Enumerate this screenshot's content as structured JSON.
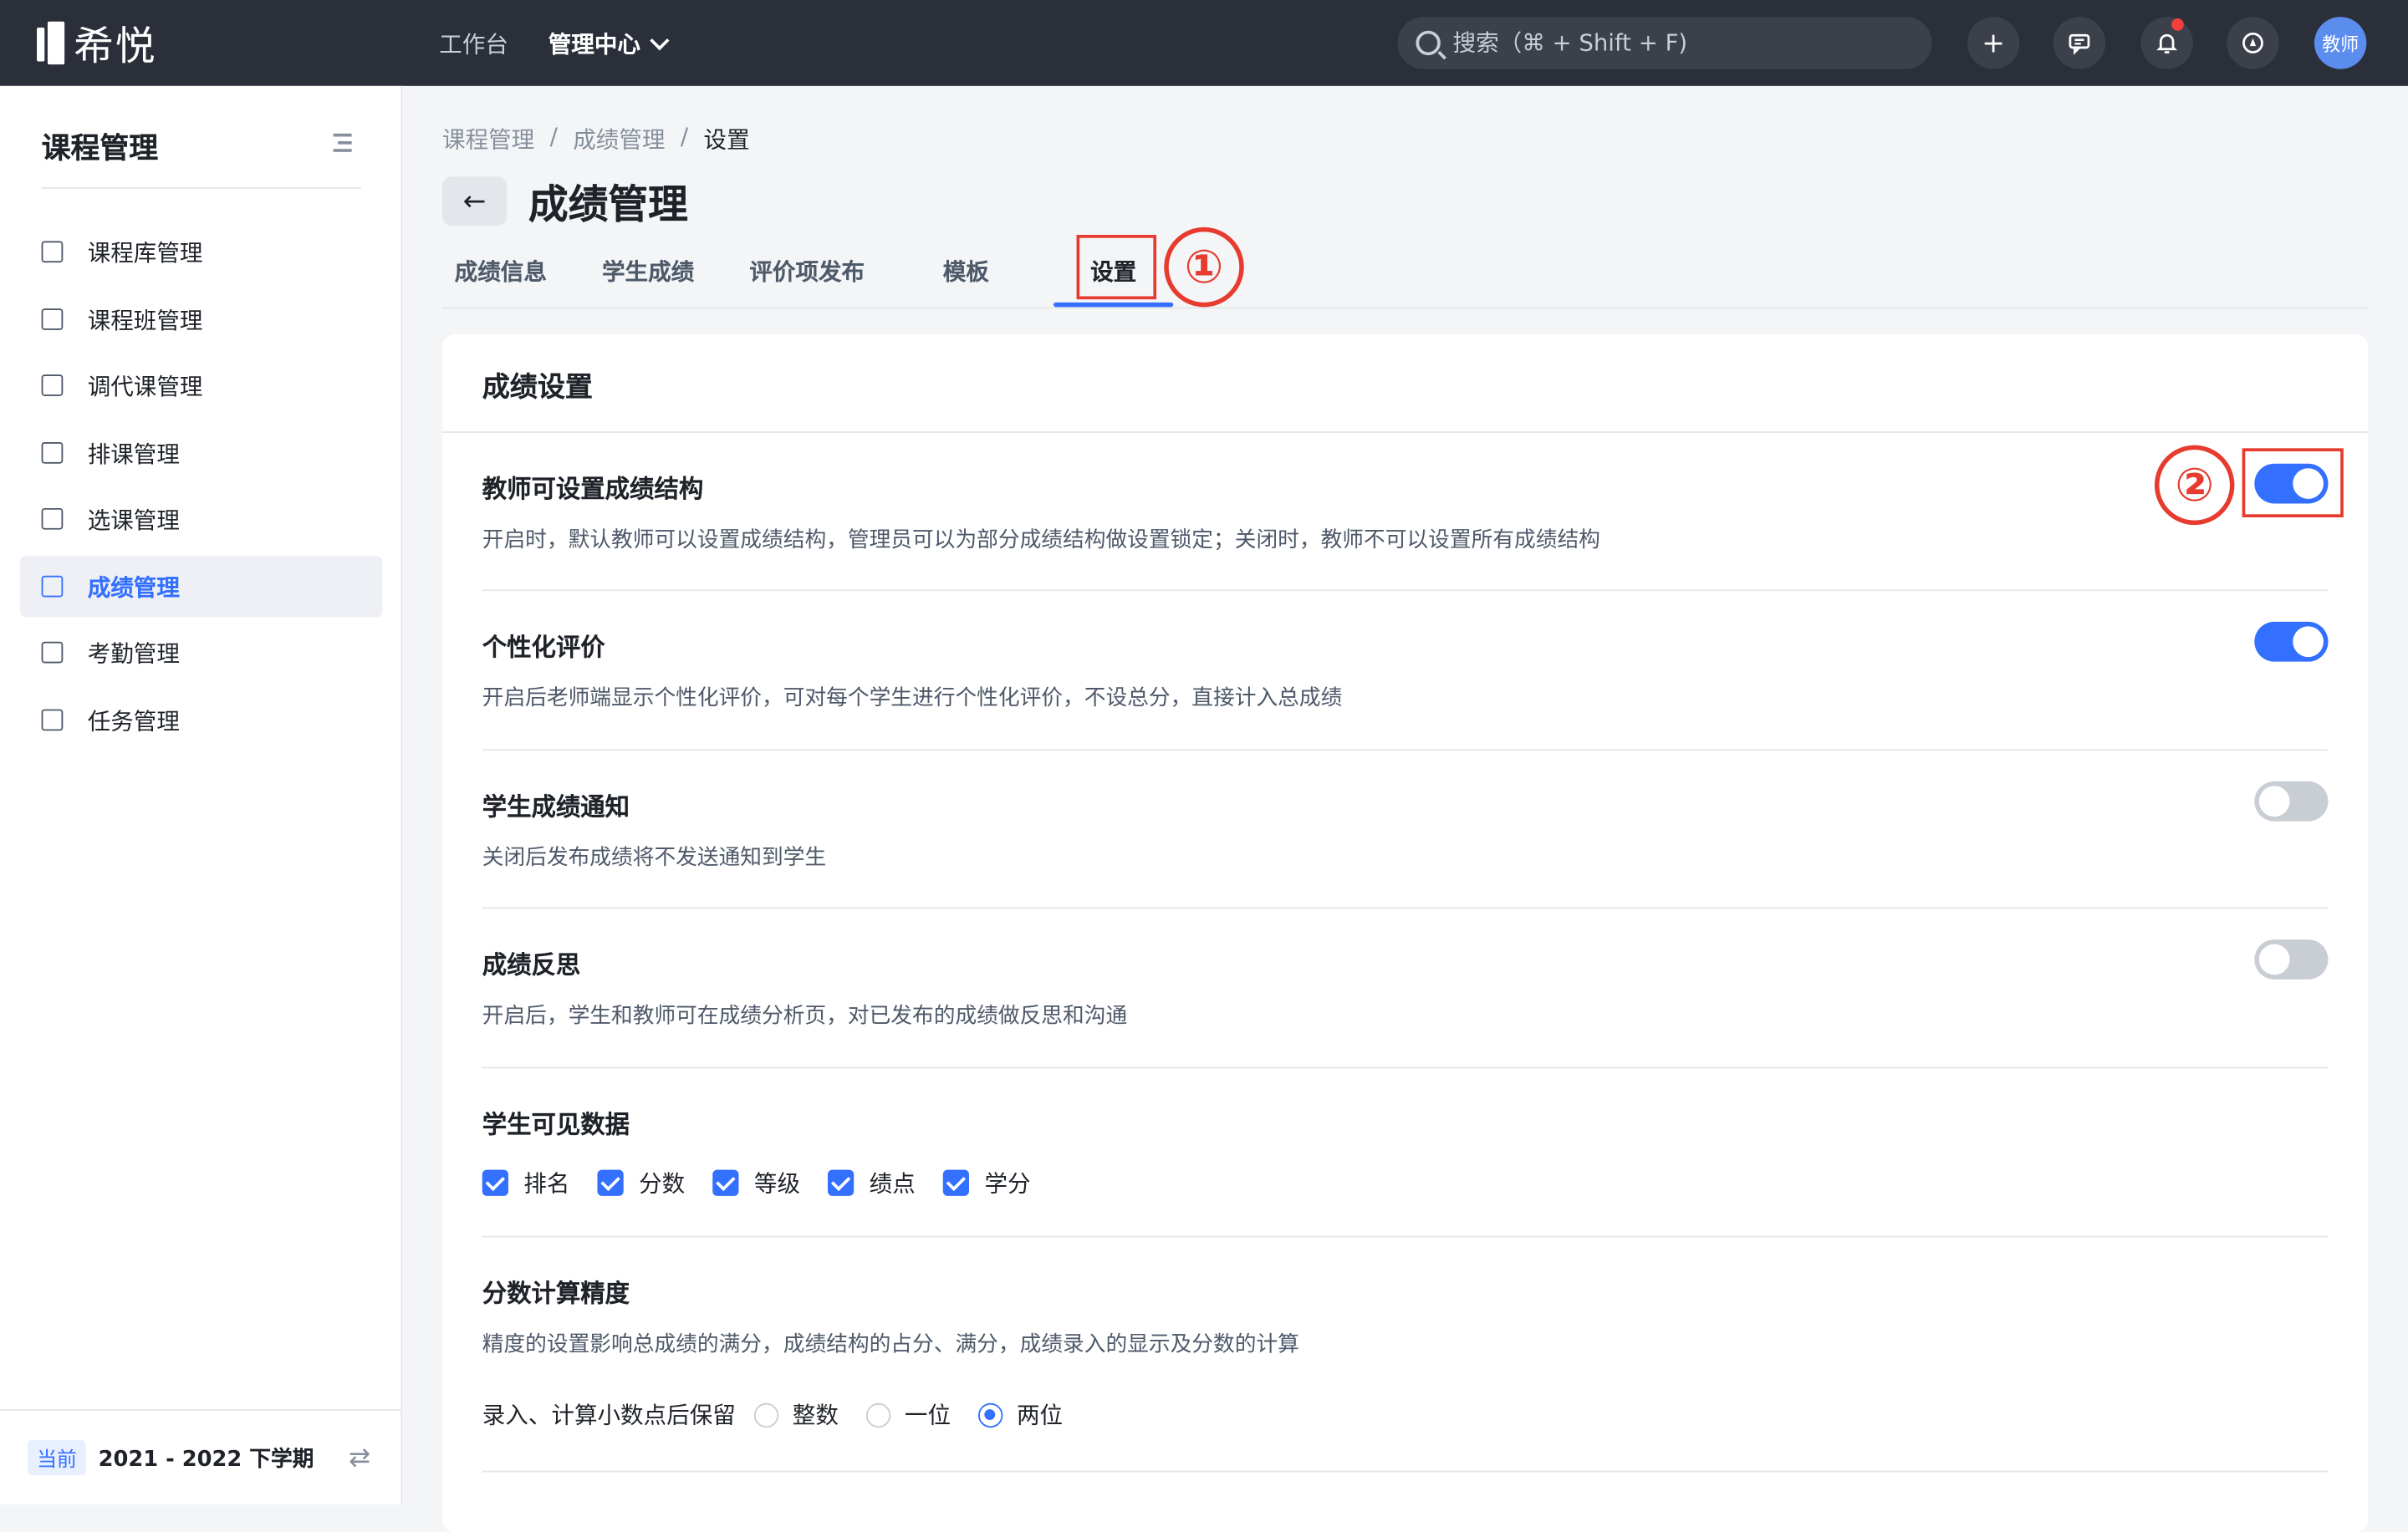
{
  "app": {
    "name": "希悦"
  },
  "topnav": {
    "workbench": "工作台",
    "admin": "管理中心"
  },
  "search": {
    "placeholder": "搜索（⌘ + Shift + F)"
  },
  "user": {
    "avatar_text": "教师"
  },
  "sidebar": {
    "title": "课程管理",
    "items": [
      {
        "label": "课程库管理",
        "icon": "course-library-icon"
      },
      {
        "label": "课程班管理",
        "icon": "course-class-icon"
      },
      {
        "label": "调代课管理",
        "icon": "substitute-icon"
      },
      {
        "label": "排课管理",
        "icon": "schedule-icon"
      },
      {
        "label": "选课管理",
        "icon": "select-course-icon"
      },
      {
        "label": "成绩管理",
        "icon": "grade-icon"
      },
      {
        "label": "考勤管理",
        "icon": "attendance-icon"
      },
      {
        "label": "任务管理",
        "icon": "task-icon"
      }
    ],
    "active_index": 5,
    "term_tag": "当前",
    "term": "2021 - 2022 下学期"
  },
  "breadcrumb": [
    "课程管理",
    "成绩管理",
    "设置"
  ],
  "page_title": "成绩管理",
  "tabs": [
    "成绩信息",
    "学生成绩",
    "评价项发布",
    "模板",
    "设置"
  ],
  "active_tab": "设置",
  "annotations": {
    "one": "①",
    "two": "②"
  },
  "settings": {
    "title": "成绩设置",
    "rows": [
      {
        "title": "教师可设置成绩结构",
        "desc": "开启时，默认教师可以设置成绩结构，管理员可以为部分成绩结构做设置锁定；关闭时，教师不可以设置所有成绩结构",
        "on": true
      },
      {
        "title": "个性化评价",
        "desc": "开启后老师端显示个性化评价，可对每个学生进行个性化评价，不设总分，直接计入总成绩",
        "on": true
      },
      {
        "title": "学生成绩通知",
        "desc": "关闭后发布成绩将不发送通知到学生",
        "on": false
      },
      {
        "title": "成绩反思",
        "desc": "开启后，学生和教师可在成绩分析页，对已发布的成绩做反思和沟通",
        "on": false
      }
    ],
    "visible_data": {
      "title": "学生可见数据",
      "options": [
        "排名",
        "分数",
        "等级",
        "绩点",
        "学分"
      ]
    },
    "precision": {
      "title": "分数计算精度",
      "desc": "精度的设置影响总成绩的满分，成绩结构的占分、满分，成绩录入的显示及分数的计算",
      "label": "录入、计算小数点后保留",
      "options": [
        "整数",
        "一位",
        "两位"
      ],
      "selected": "两位"
    }
  }
}
